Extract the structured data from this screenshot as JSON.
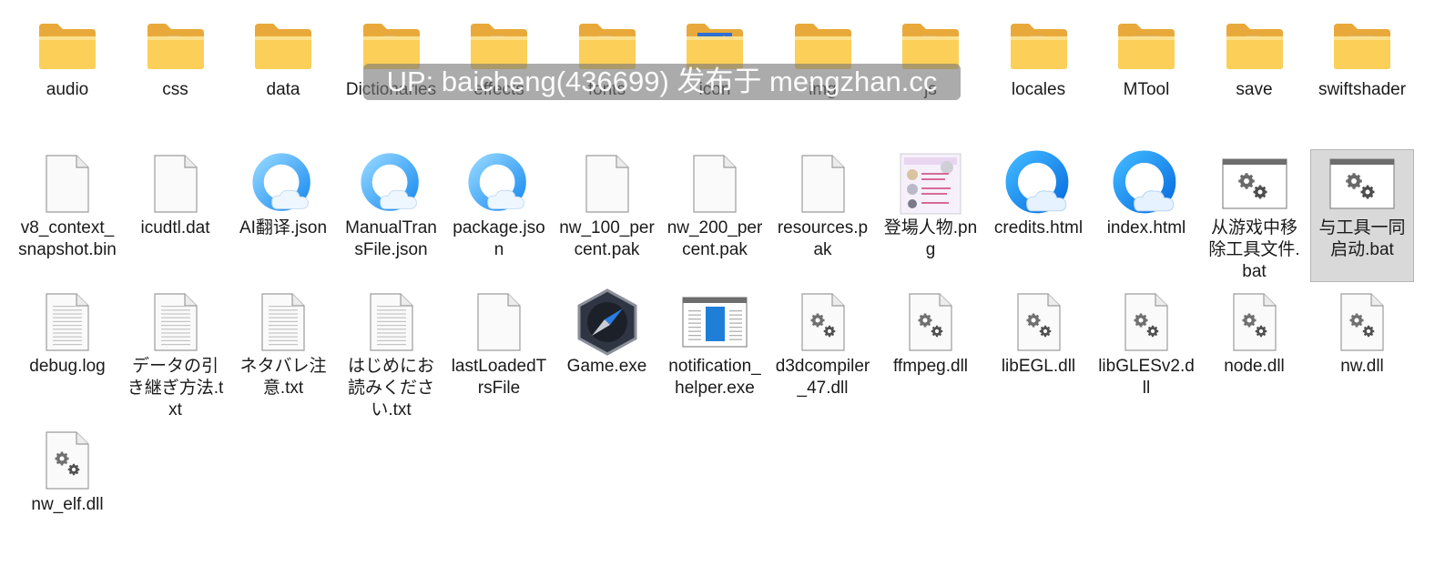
{
  "watermark": "UP: baicheng(436699) 发布于 mengzhan.cc",
  "items": [
    {
      "label": "audio",
      "icon": "folder-icon",
      "kind": "folder",
      "content": "empty"
    },
    {
      "label": "css",
      "icon": "folder-icon",
      "kind": "folder",
      "content": "doc"
    },
    {
      "label": "data",
      "icon": "folder-icon",
      "kind": "folder",
      "content": "browser"
    },
    {
      "label": "Dictionaries",
      "icon": "folder-icon",
      "kind": "folder",
      "content": "doc"
    },
    {
      "label": "effects",
      "icon": "folder-icon",
      "kind": "folder",
      "content": "doc"
    },
    {
      "label": "fonts",
      "icon": "folder-icon",
      "kind": "folder",
      "content": "doc"
    },
    {
      "label": "icon",
      "icon": "folder-icon",
      "kind": "folder",
      "content": "image"
    },
    {
      "label": "img",
      "icon": "folder-icon",
      "kind": "folder",
      "content": "empty"
    },
    {
      "label": "js",
      "icon": "folder-icon",
      "kind": "folder",
      "content": "doc"
    },
    {
      "label": "locales",
      "icon": "folder-icon",
      "kind": "folder",
      "content": "doc"
    },
    {
      "label": "MTool",
      "icon": "folder-icon",
      "kind": "folder",
      "content": "gear"
    },
    {
      "label": "save",
      "icon": "folder-icon",
      "kind": "folder",
      "content": "doc"
    },
    {
      "label": "swiftshader",
      "icon": "folder-icon",
      "kind": "folder",
      "content": "gear"
    },
    {
      "label": "v8_context_snapshot.bin",
      "icon": "blank-file-icon",
      "kind": "blank"
    },
    {
      "label": "icudtl.dat",
      "icon": "blank-file-icon",
      "kind": "blank"
    },
    {
      "label": "AI翻译.json",
      "icon": "browser-file-icon",
      "kind": "browser"
    },
    {
      "label": "ManualTransFile.json",
      "icon": "browser-file-icon",
      "kind": "browser"
    },
    {
      "label": "package.json",
      "icon": "browser-file-icon",
      "kind": "browser"
    },
    {
      "label": "nw_100_percent.pak",
      "icon": "blank-file-icon",
      "kind": "blank"
    },
    {
      "label": "nw_200_percent.pak",
      "icon": "blank-file-icon",
      "kind": "blank"
    },
    {
      "label": "resources.pak",
      "icon": "blank-file-icon",
      "kind": "blank"
    },
    {
      "label": "登場人物.png",
      "icon": "image-thumbnail-icon",
      "kind": "image"
    },
    {
      "label": "credits.html",
      "icon": "browser-icon",
      "kind": "browser-big"
    },
    {
      "label": "index.html",
      "icon": "browser-icon",
      "kind": "browser-big"
    },
    {
      "label": "从游戏中移除工具文件.bat",
      "icon": "batch-file-icon",
      "kind": "bat"
    },
    {
      "label": "与工具一同启动.bat",
      "icon": "batch-file-icon",
      "kind": "bat",
      "selected": true
    },
    {
      "label": "debug.log",
      "icon": "text-file-icon",
      "kind": "text"
    },
    {
      "label": "データの引き継ぎ方法.txt",
      "icon": "text-file-icon",
      "kind": "text"
    },
    {
      "label": "ネタバレ注意.txt",
      "icon": "text-file-icon",
      "kind": "text"
    },
    {
      "label": "はじめにお読みください.txt",
      "icon": "text-file-icon",
      "kind": "text"
    },
    {
      "label": "lastLoadedTrsFile",
      "icon": "blank-file-icon",
      "kind": "blank"
    },
    {
      "label": "Game.exe",
      "icon": "compass-app-icon",
      "kind": "exe"
    },
    {
      "label": "notification_helper.exe",
      "icon": "app-window-icon",
      "kind": "window"
    },
    {
      "label": "d3dcompiler_47.dll",
      "icon": "dll-file-icon",
      "kind": "dll"
    },
    {
      "label": "ffmpeg.dll",
      "icon": "dll-file-icon",
      "kind": "dll"
    },
    {
      "label": "libEGL.dll",
      "icon": "dll-file-icon",
      "kind": "dll"
    },
    {
      "label": "libGLESv2.dll",
      "icon": "dll-file-icon",
      "kind": "dll"
    },
    {
      "label": "node.dll",
      "icon": "dll-file-icon",
      "kind": "dll"
    },
    {
      "label": "nw.dll",
      "icon": "dll-file-icon",
      "kind": "dll"
    },
    {
      "label": "nw_elf.dll",
      "icon": "dll-file-icon",
      "kind": "dll"
    }
  ]
}
